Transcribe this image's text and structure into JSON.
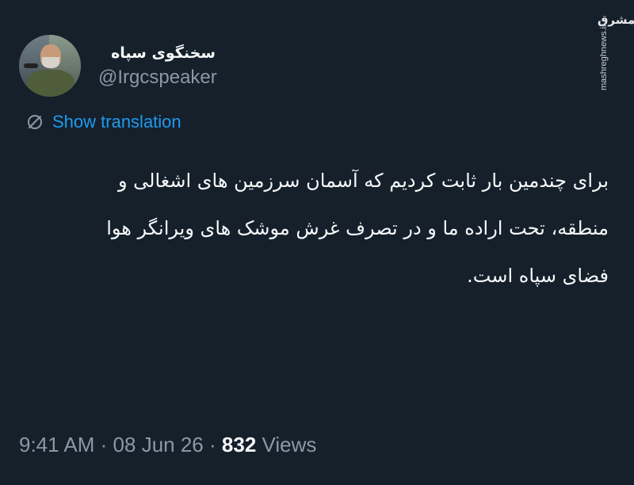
{
  "tweet": {
    "author": {
      "display_name": "سخنگوی سپاه",
      "handle": "@Irgcspeaker"
    },
    "translate_label": "Show translation",
    "text_lines": [
      "برای چندمین بار ثابت کردیم که آسمان سرزمین های اشغالی و",
      "منطقه، تحت اراده ما و در تصرف غرش موشک های ویرانگر هوا",
      "فضای سپاه است."
    ],
    "meta": {
      "time": "9:41 AM",
      "separator": "·",
      "date": "08 Jun 26",
      "views_count": "832",
      "views_label": "Views"
    }
  },
  "watermark": {
    "logo_text": "مشرق",
    "url": "mashreghnews.ir"
  },
  "colors": {
    "background": "#15202b",
    "text_primary": "#f7f9f9",
    "text_secondary": "#8b98a5",
    "accent": "#1d9bf0"
  },
  "icons": {
    "translate": "translate-icon"
  }
}
